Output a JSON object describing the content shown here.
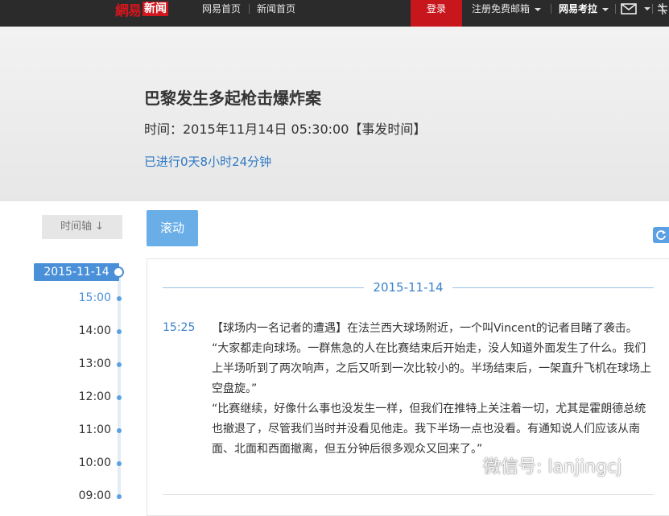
{
  "nav": {
    "logo_main": "網易",
    "logo_sub": "新闻",
    "home": "网易首页",
    "news_home": "新闻首页",
    "login": "登录",
    "register_mail": "注册免费邮箱",
    "netease_pass": "网易考拉"
  },
  "icons": {
    "mail": "mail-icon",
    "menu": "grid-menu-icon",
    "refresh": "refresh-icon",
    "watermark": "wechat-icon"
  },
  "header": {
    "title": "巴黎发生多起枪击爆炸案",
    "time": "时间：2015年11月14日 05:30:00【事发时间】",
    "elapsed": "已进行0天8小时24分钟"
  },
  "timeline": {
    "toggle_label": "时间轴 ↓",
    "date": "2015-11-14",
    "hours": [
      {
        "label": "15:00",
        "active": true
      },
      {
        "label": "14:00",
        "active": false
      },
      {
        "label": "13:00",
        "active": false
      },
      {
        "label": "12:00",
        "active": false
      },
      {
        "label": "11:00",
        "active": false
      },
      {
        "label": "10:00",
        "active": false
      },
      {
        "label": "09:00",
        "active": false
      }
    ]
  },
  "content": {
    "scroll_label": "滚动",
    "date_header": "2015-11-14",
    "entries": [
      {
        "time": "15:25",
        "paragraphs": [
          "【球场内一名记者的遭遇】在法兰西大球场附近，一个叫Vincent的记者目睹了袭击。",
          "“大家都走向球场。一群焦急的人在比赛结束后开始走，没人知道外面发生了什么。我们上半场听到了两次响声，之后又听到一次比较小的。半场结束后，一架直升飞机在球场上空盘旋。”",
          "“比赛继续，好像什么事也没发生一样，但我们在推特上关注着一切，尤其是霍朗德总统也撤退了，尽管我们当时并没看见他走。我下半场一点也没看。有通知说人们应该从南面、北面和西面撤离，但五分钟后很多观众又回来了。”"
        ]
      }
    ]
  },
  "watermark": {
    "text": "微信号: lanjingcj"
  },
  "colors": {
    "accent_blue": "#4a90d9",
    "brand_red": "#c8161d",
    "topbar": "#2b2b2b"
  }
}
